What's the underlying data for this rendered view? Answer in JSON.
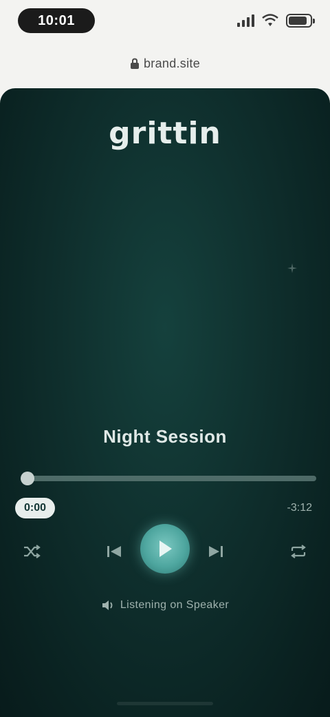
{
  "status_bar": {
    "time": "10:01",
    "icons": [
      "signal-icon",
      "wifi-icon",
      "battery-icon"
    ],
    "battery_level": 0.85
  },
  "browser": {
    "address": "brand.site",
    "lock_icon": "lock-icon"
  },
  "player": {
    "brand": "grittin",
    "track_title": "Night Session",
    "elapsed": "0:00",
    "remaining": "-3:12",
    "progress": 0.0,
    "device_label": "Listening on Speaker",
    "icons": {
      "shuffle": "shuffle-icon",
      "previous": "previous-icon",
      "play": "play-icon",
      "next": "next-icon",
      "repeat": "repeat-icon",
      "speaker": "speaker-icon",
      "sparkle": "sparkle-icon"
    }
  },
  "colors": {
    "background_top": "#f3f3f1",
    "player_dark": "#0f2f2d",
    "accent": "#4ea69f",
    "text_light": "#dfe8e6"
  }
}
